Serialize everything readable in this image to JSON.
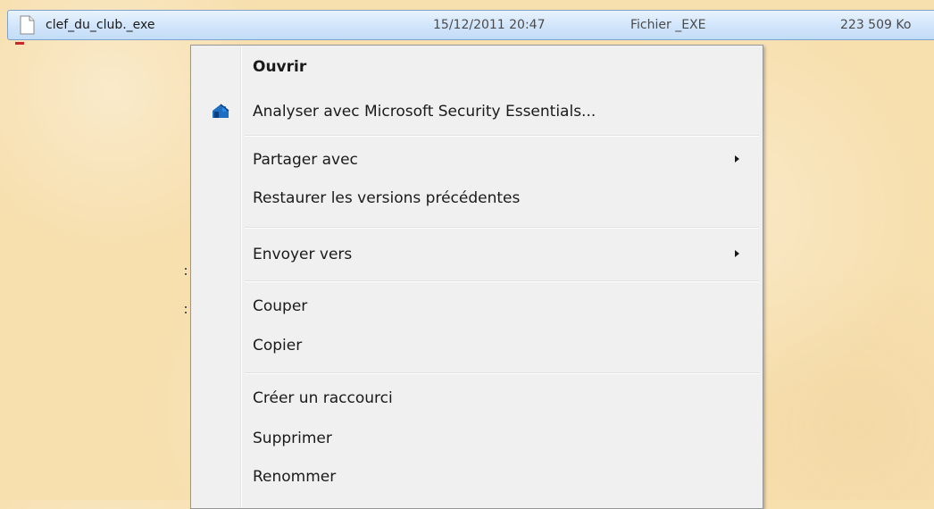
{
  "file": {
    "name": "clef_du_club._exe",
    "modified": "15/12/2011 20:47",
    "type": "Fichier _EXE",
    "size": "223 509 Ko",
    "icon": "document-icon"
  },
  "context_menu": {
    "items": [
      {
        "label": "Ouvrir",
        "bold": true
      },
      {
        "label": "Analyser avec Microsoft Security Essentials...",
        "icon": "security-essentials-icon",
        "icon_color": "#1e6fc2"
      },
      {
        "label": "Partager avec",
        "submenu": true
      },
      {
        "label": "Restaurer les versions précédentes"
      },
      {
        "label": "Envoyer vers",
        "submenu": true
      },
      {
        "label": "Couper"
      },
      {
        "label": "Copier"
      },
      {
        "label": "Créer un raccourci"
      },
      {
        "label": "Supprimer"
      },
      {
        "label": "Renommer"
      }
    ]
  },
  "colors": {
    "desktop_background": "#f7dfae",
    "selection_border": "#7da2ce",
    "menu_background": "#f0f0f0"
  }
}
